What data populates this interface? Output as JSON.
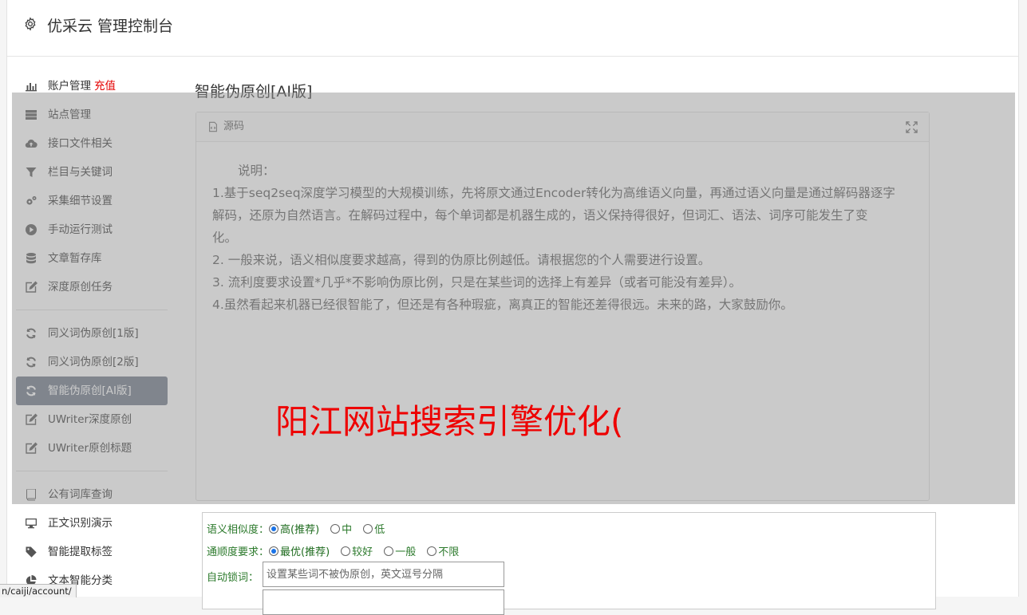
{
  "app": {
    "title": "优采云 管理控制台"
  },
  "sidebar": {
    "group1": [
      {
        "label": "账户管理",
        "extra": "充值",
        "icon": "bar-chart-icon"
      },
      {
        "label": "站点管理",
        "icon": "server-icon"
      },
      {
        "label": "接口文件相关",
        "icon": "cloud-upload-icon"
      },
      {
        "label": "栏目与关键词",
        "icon": "filter-icon"
      },
      {
        "label": "采集细节设置",
        "icon": "gears-icon"
      },
      {
        "label": "手动运行测试",
        "icon": "play-circle-icon"
      },
      {
        "label": "文章暂存库",
        "icon": "database-icon"
      },
      {
        "label": "深度原创任务",
        "icon": "edit-icon"
      }
    ],
    "group2": [
      {
        "label": "同义词伪原创[1版]",
        "icon": "refresh-icon"
      },
      {
        "label": "同义词伪原创[2版]",
        "icon": "refresh-icon"
      },
      {
        "label": "智能伪原创[AI版]",
        "icon": "refresh-icon",
        "active": true
      },
      {
        "label": "UWriter深度原创",
        "icon": "edit-icon"
      },
      {
        "label": "UWriter原创标题",
        "icon": "edit-icon"
      }
    ],
    "group3": [
      {
        "label": "公有词库查询",
        "icon": "book-icon"
      },
      {
        "label": "正文识别演示",
        "icon": "desktop-icon"
      },
      {
        "label": "智能提取标签",
        "icon": "tag-icon"
      },
      {
        "label": "文本智能分类",
        "icon": "pie-chart-icon"
      }
    ]
  },
  "main": {
    "title": "智能伪原创[AI版]",
    "panel": {
      "header": "源码",
      "lines": [
        "说明：",
        "1.基于seq2seq深度学习模型的大规模训练，先将原文通过Encoder转化为高维语义向量，再通过语义向量是通过解码器逐字",
        "解码，还原为自然语言。在解码过程中，每个单词都是机器生成的，语义保持得很好，但词汇、语法、词序可能发生了变",
        "化。",
        "2. 一般来说，语义相似度要求越高，得到的伪原比例越低。请根据您的个人需要进行设置。",
        "3. 流利度要求设置*几乎*不影响伪原比例，只是在某些词的选择上有差异（或者可能没有差异）。",
        "4.虽然看起来机器已经很智能了，但还是有各种瑕疵，离真正的智能还差得很远。未来的路，大家鼓励你。"
      ]
    }
  },
  "watermark": "阳江网站搜索引擎优化(",
  "form": {
    "similarity": {
      "label": "语义相似度：",
      "options": [
        "高(推荐)",
        "中",
        "低"
      ],
      "selected": "高(推荐)"
    },
    "fluency": {
      "label": "通顺度要求：",
      "options": [
        "最优(推荐)",
        "较好",
        "一般",
        "不限"
      ],
      "selected": "最优(推荐)"
    },
    "lock": {
      "label": "自动锁词：",
      "placeholder": "设置某些词不被伪原创，英文逗号分隔"
    }
  },
  "statusbar": {
    "url": "n/caiji/account/"
  },
  "colors": {
    "active_nav": "#6b7585",
    "recharge": "#e40000",
    "watermark": "#ee0000",
    "form_label": "#2c7a2c"
  }
}
